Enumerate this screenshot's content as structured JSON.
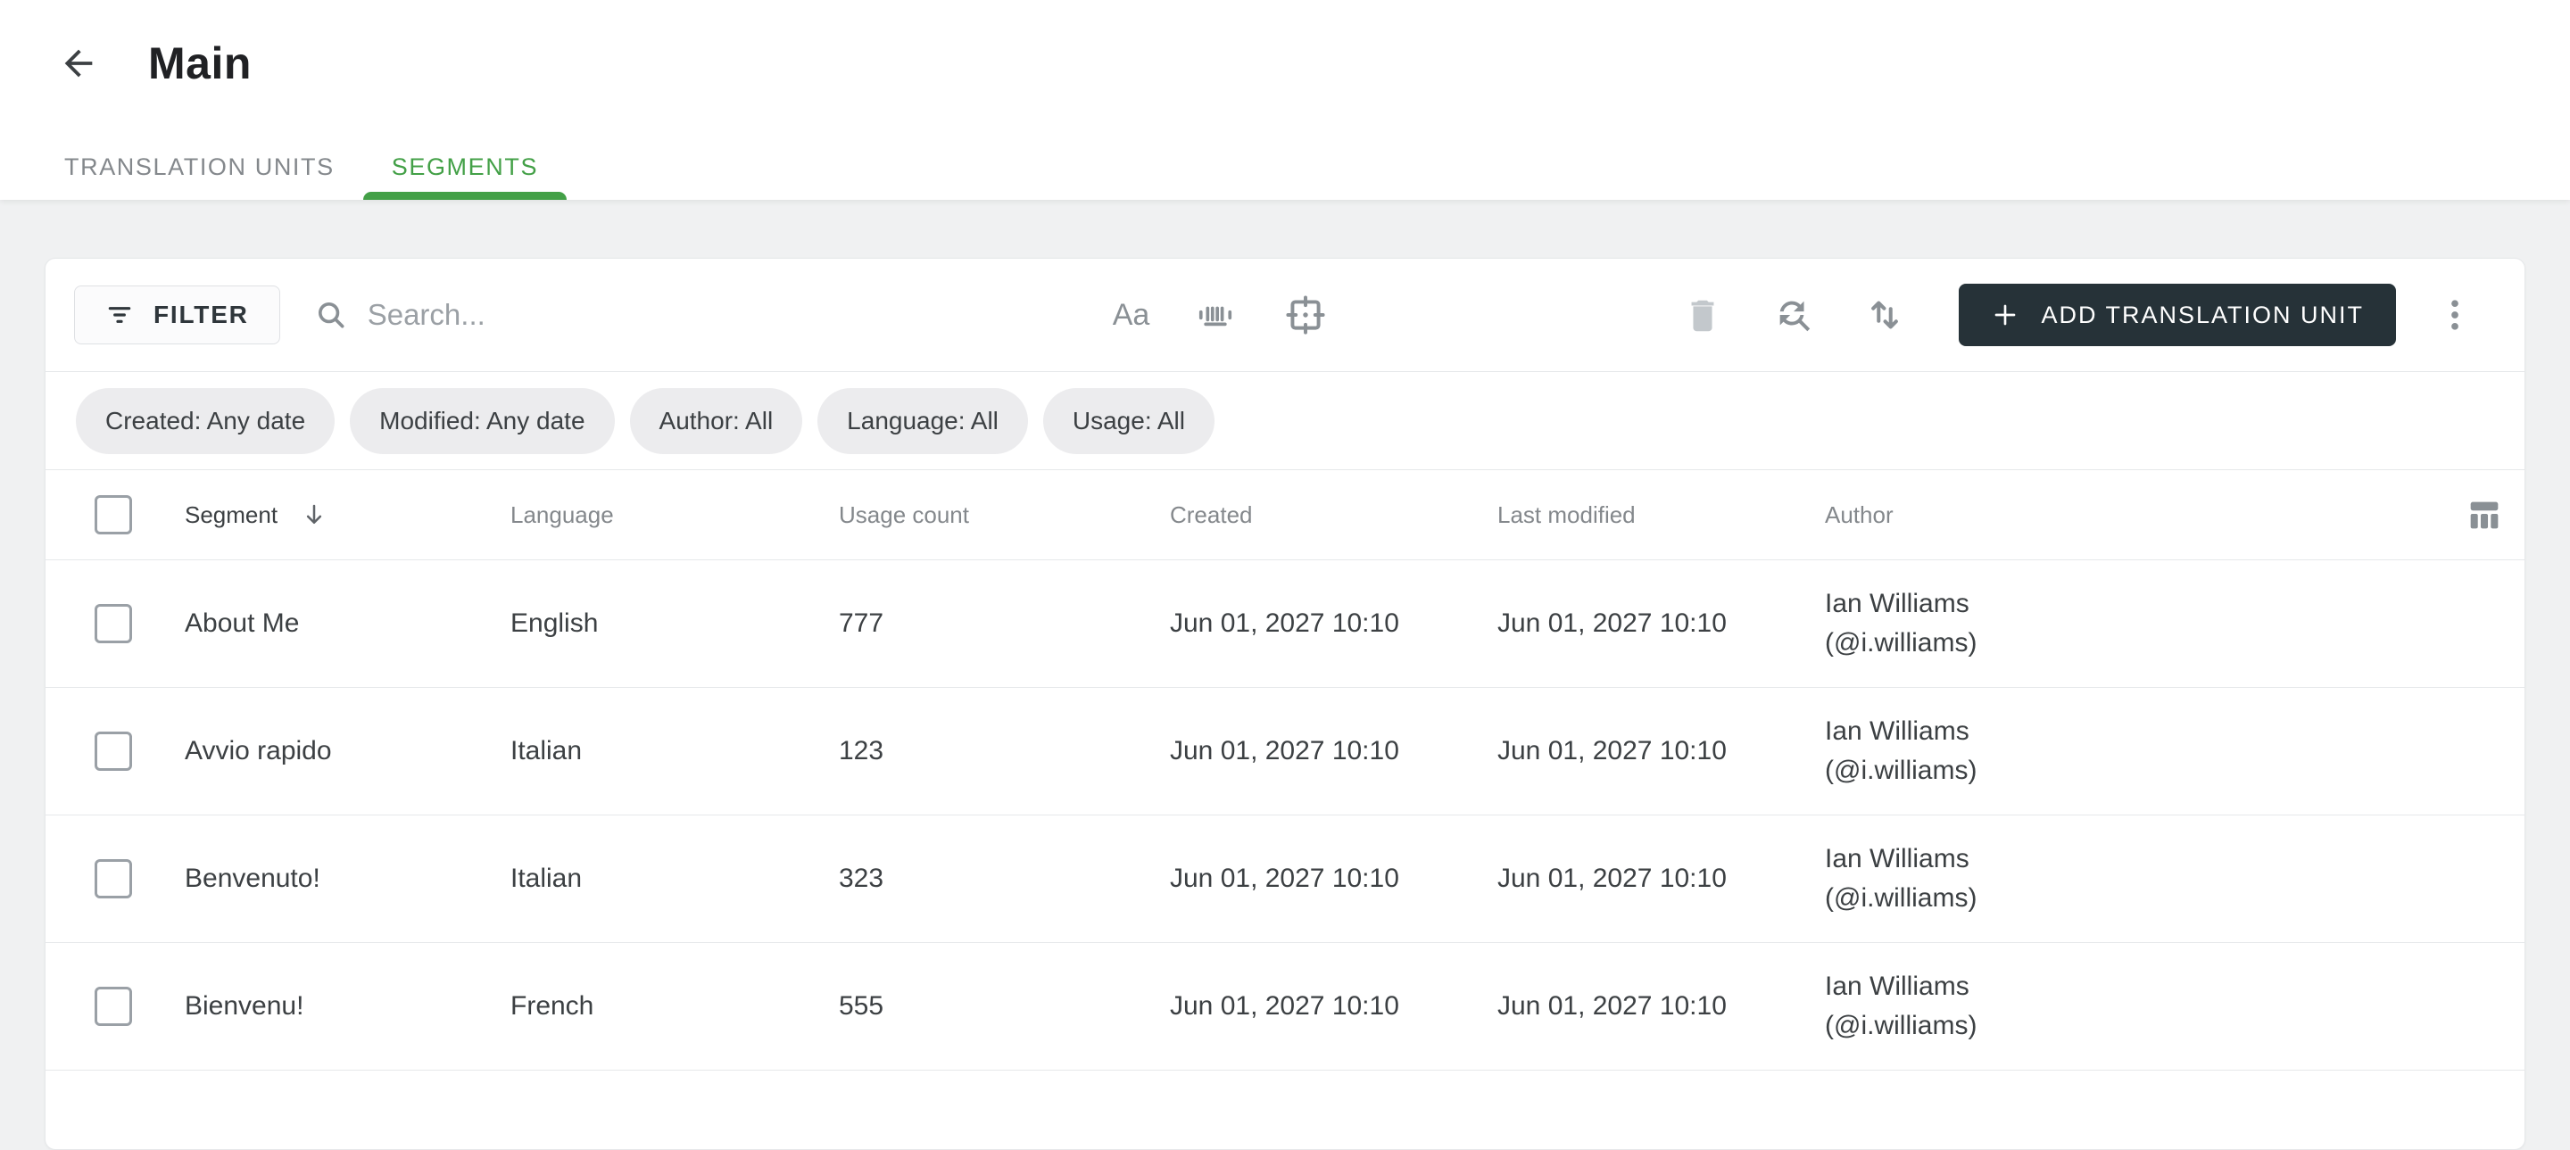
{
  "header": {
    "title": "Main"
  },
  "tabs": [
    {
      "label": "TRANSLATION UNITS",
      "active": false
    },
    {
      "label": "SEGMENTS",
      "active": true
    }
  ],
  "toolbar": {
    "filter_label": "FILTER",
    "search_placeholder": "Search...",
    "match_case_label": "Aa",
    "add_button_label": "ADD TRANSLATION UNIT"
  },
  "filter_chips": [
    "Created: Any date",
    "Modified: Any date",
    "Author: All",
    "Language: All",
    "Usage: All"
  ],
  "table": {
    "columns": [
      "Segment",
      "Language",
      "Usage count",
      "Created",
      "Last modified",
      "Author"
    ],
    "rows": [
      {
        "segment": "About Me",
        "language": "English",
        "usage_count": "777",
        "created": "Jun 01, 2027 10:10",
        "last_modified": "Jun 01, 2027 10:10",
        "author_name": "Ian Williams",
        "author_handle": "(@i.williams)"
      },
      {
        "segment": "Avvio rapido",
        "language": "Italian",
        "usage_count": "123",
        "created": "Jun 01, 2027 10:10",
        "last_modified": "Jun 01, 2027 10:10",
        "author_name": "Ian Williams",
        "author_handle": "(@i.williams)"
      },
      {
        "segment": "Benvenuto!",
        "language": "Italian",
        "usage_count": "323",
        "created": "Jun 01, 2027 10:10",
        "last_modified": "Jun 01, 2027 10:10",
        "author_name": "Ian Williams",
        "author_handle": "(@i.williams)"
      },
      {
        "segment": "Bienvenu!",
        "language": "French",
        "usage_count": "555",
        "created": "Jun 01, 2027 10:10",
        "last_modified": "Jun 01, 2027 10:10",
        "author_name": "Ian Williams",
        "author_handle": "(@i.williams)"
      }
    ]
  },
  "colors": {
    "accent_green": "#43a047",
    "button_dark": "#263238",
    "page_background": "#f0f1f2"
  }
}
